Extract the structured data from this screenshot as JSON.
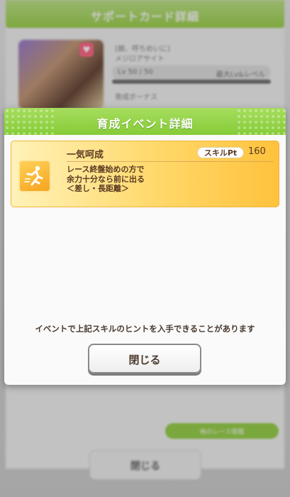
{
  "background": {
    "header_title": "サポートカード詳細",
    "card_title": "[願、呼ちめいに]",
    "card_name": "メジロアサイト",
    "level": "Lv 50 / 50",
    "level_extra": "最大Lv&レベル",
    "effect_label": "育成ボーナス",
    "green_button": "他のレース情報",
    "close_label": "閉じる"
  },
  "modal": {
    "title": "育成イベント詳細",
    "skill": {
      "name": "一気呵成",
      "pt_label": "スキルPt",
      "pt_value": "160",
      "desc_line1": "レース終盤始めの方で",
      "desc_line2": "余力十分なら前に出る",
      "desc_line3": "＜差し・長距離＞",
      "icon": "running-figure-icon"
    },
    "note": "イベントで上記スキルのヒントを入手できることがあります",
    "close_label": "閉じる"
  },
  "colors": {
    "header_green": "#8fd242",
    "skill_gold": "#ffc23c",
    "text_brown": "#5a3a22"
  }
}
